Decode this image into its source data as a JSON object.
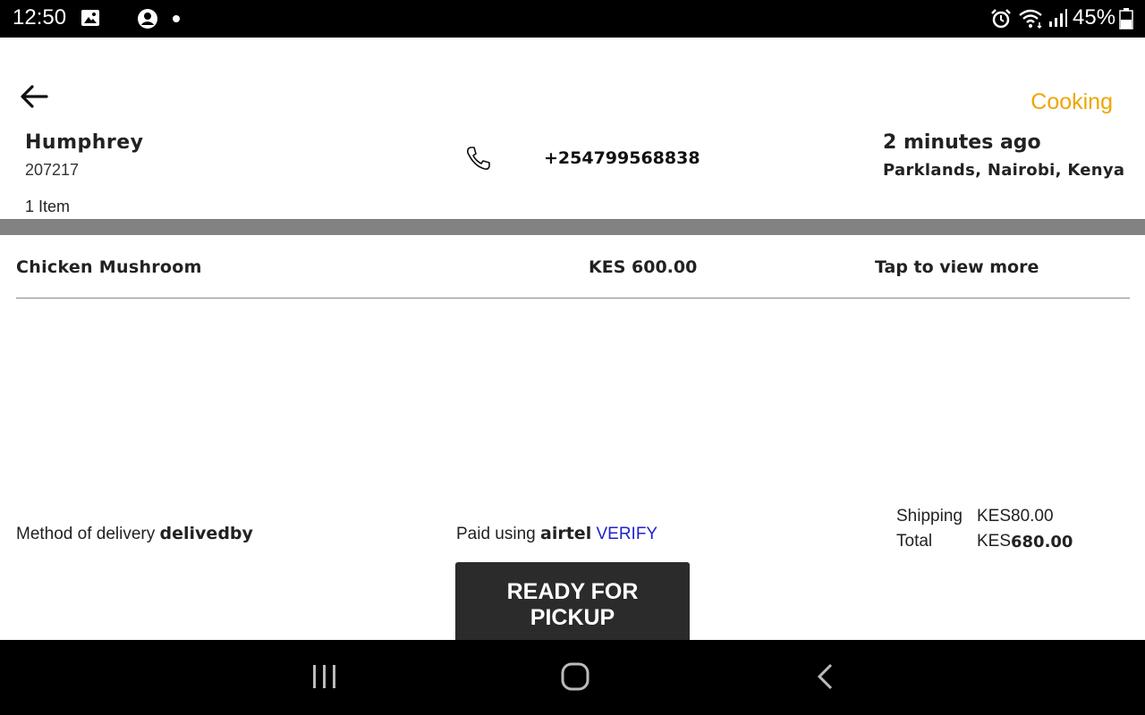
{
  "status_bar": {
    "time": "12:50",
    "battery_percent": "45%",
    "icons": [
      "image-icon",
      "moon-icon",
      "account-icon",
      "alarm-icon",
      "wifi-icon",
      "signal-icon",
      "battery-icon"
    ]
  },
  "order": {
    "status": "Cooking",
    "status_color": "#f0a500",
    "customer_name": "Humphrey",
    "customer_id": "207217",
    "item_count": "1 Item",
    "phone": "+254799568838",
    "time_ago": "2 minutes ago",
    "location": "Parklands, Nairobi, Kenya"
  },
  "items": [
    {
      "name": "Chicken Mushroom",
      "price": "KES 600.00",
      "action": "Tap to view more"
    }
  ],
  "footer": {
    "delivery_label": "Method of delivery",
    "delivery_value": "delivedby",
    "payment_label": "Paid using",
    "payment_value": "airtel",
    "verify_label": "VERIFY",
    "verify_color": "#2222cc",
    "shipping_label": "Shipping",
    "shipping_currency": "KES",
    "shipping_value": "80.00",
    "total_label": "Total",
    "total_currency": "KES",
    "total_value": "680.00",
    "ready_line1": "READY FOR",
    "ready_line2": "PICKUP"
  },
  "nav_bar": {
    "icons": [
      "recent-apps-icon",
      "home-icon",
      "back-nav-icon"
    ]
  }
}
